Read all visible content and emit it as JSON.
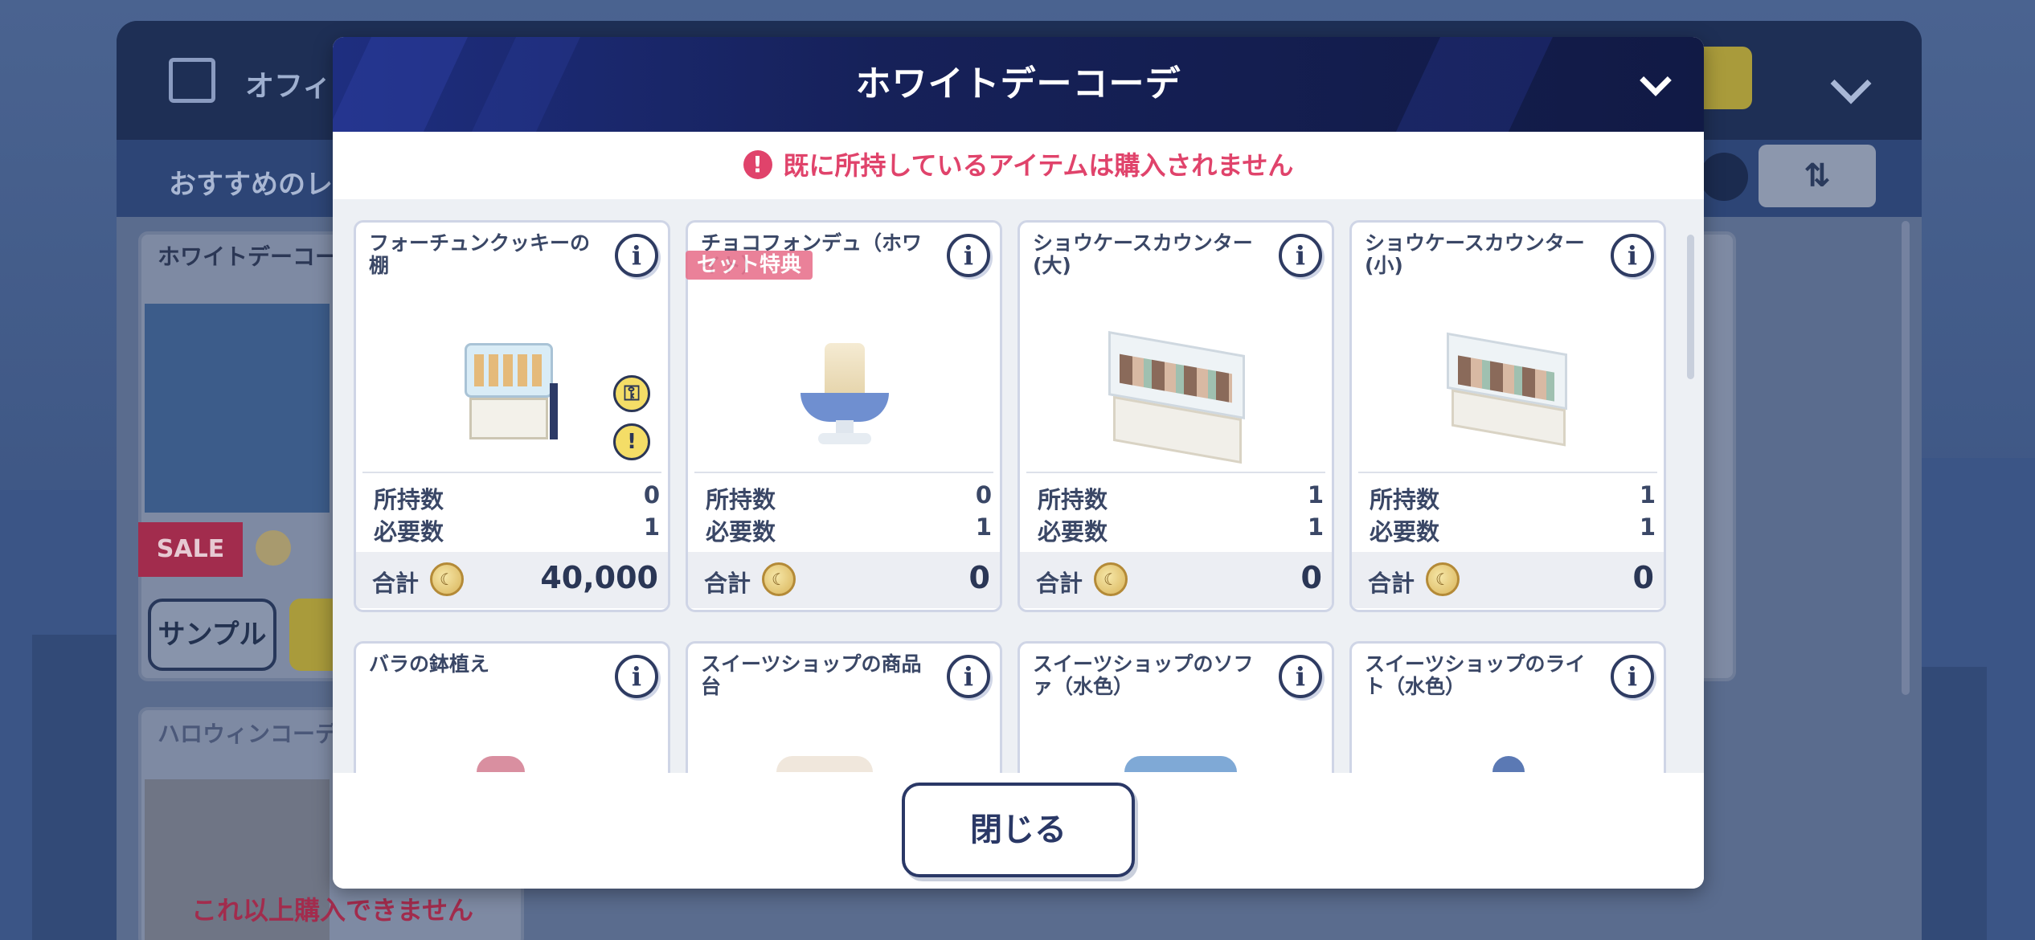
{
  "background": {
    "header_title": "オフィ",
    "subheader_text": "おすすめのレ",
    "card1_title": "ホワイトデーコー",
    "card1_sale": "SALE",
    "card1_sample": "サンプル",
    "card2_title": "ハロウィンコーデ",
    "card2_warning": "これ以上購入できません",
    "sort_icon": "sort-arrows-icon"
  },
  "modal": {
    "title": "ホワイトデーコーデ",
    "notice": "既に所持しているアイテムは購入されません",
    "notice_icon": "!",
    "close_label": "閉じる",
    "set_bonus_label": "セット特典",
    "colors": {
      "accent_red": "#e0436b",
      "header_navy": "#162159"
    }
  },
  "labels": {
    "owned": "所持数",
    "required": "必要数",
    "total": "合計",
    "info": "i"
  },
  "items": [
    {
      "name": "フォーチュンクッキーの棚",
      "owned": "0",
      "required": "1",
      "total": "40,000"
    },
    {
      "name": "チョコフォンデュ（ホワイト）",
      "owned": "0",
      "required": "1",
      "total": "0"
    },
    {
      "name": "ショウケースカウンター(大)",
      "owned": "1",
      "required": "1",
      "total": "0"
    },
    {
      "name": "ショウケースカウンター(小)",
      "owned": "1",
      "required": "1",
      "total": "0"
    },
    {
      "name": "バラの鉢植え"
    },
    {
      "name": "スイーツショップの商品台"
    },
    {
      "name": "スイーツショップのソファ（水色）"
    },
    {
      "name": "スイーツショップのライト（水色）"
    }
  ]
}
